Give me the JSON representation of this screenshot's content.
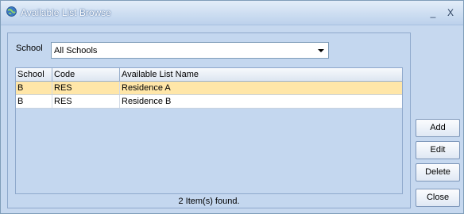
{
  "window": {
    "title": "Available List Browse",
    "minimize_glyph": "_",
    "close_glyph": "X"
  },
  "filter": {
    "label": "School",
    "selected": "All Schools"
  },
  "grid": {
    "columns": [
      "School",
      "Code",
      "Available List Name"
    ],
    "rows": [
      {
        "school": "B",
        "code": "RES",
        "name": "Residence A",
        "selected": true
      },
      {
        "school": "B",
        "code": "RES",
        "name": "Residence B",
        "selected": false
      }
    ]
  },
  "status": "2 Item(s) found.",
  "buttons": {
    "add": "Add",
    "edit": "Edit",
    "delete": "Delete",
    "close": "Close"
  },
  "colors": {
    "selected_row": "#ffe6a8",
    "background": "#c6d8ef"
  }
}
